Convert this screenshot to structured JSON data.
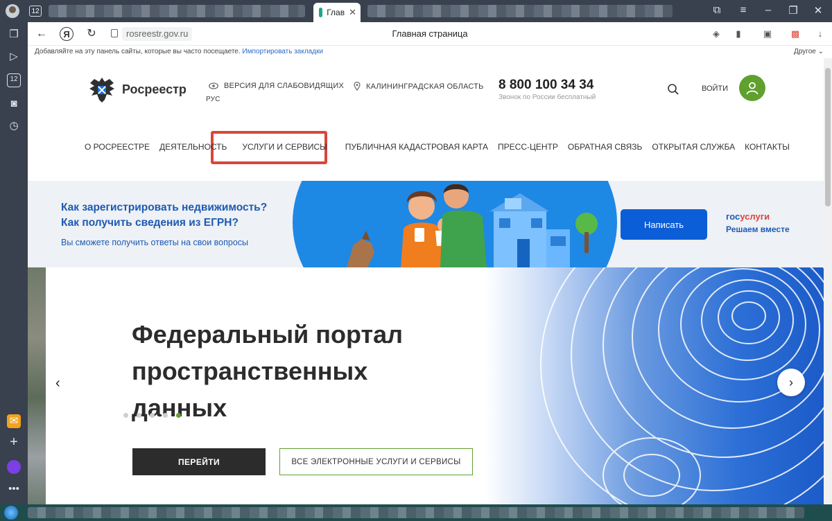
{
  "browser": {
    "tab_count": "12",
    "active_tab_label": "Глав",
    "url": "rosreestr.gov.ru",
    "page_title": "Главная страница",
    "bookmarks_hint": "Добавляйте на эту панель сайты, которые вы часто посещаете.",
    "bookmarks_import": "Импортировать закладки",
    "bookmarks_other": "Другое",
    "sidebar_tab_count": "12"
  },
  "header": {
    "logo_text": "Росреестр",
    "accessibility_label": "ВЕРСИЯ ДЛЯ СЛАБОВИДЯЩИХ",
    "region_label": "КАЛИНИНГРАДСКАЯ ОБЛАСТЬ",
    "language": "РУС",
    "phone": "8 800 100 34 34",
    "phone_note": "Звонок по России бесплатный",
    "login_label": "ВОЙТИ"
  },
  "menu": {
    "items": [
      "О РОСРЕЕСТРЕ",
      "ДЕЯТЕЛЬНОСТЬ",
      "УСЛУГИ И СЕРВИСЫ",
      "ПУБЛИЧНАЯ КАДАСТРОВАЯ КАРТА",
      "ПРЕСС-ЦЕНТР",
      "ОБРАТНАЯ СВЯЗЬ",
      "ОТКРЫТАЯ СЛУЖБА",
      "КОНТАКТЫ"
    ],
    "highlighted_index": 2,
    "highlight_color": "#d9463b"
  },
  "banner": {
    "question_1": "Как зарегистрировать недвижимость?",
    "question_2": "Как получить сведения из ЕГРН?",
    "subtitle": "Вы сможете получить ответы на свои вопросы",
    "write_button": "Написать",
    "gosuslugi_part1": "гос",
    "gosuslugi_part2": "услуги",
    "gosuslugi_tagline": "Решаем вместе"
  },
  "hero": {
    "title": "Федеральный портал пространственных данных",
    "go_button": "ПЕРЕЙТИ",
    "all_services_button": "ВСЕ ЭЛЕКТРОННЫЕ УСЛУГИ И СЕРВИСЫ",
    "slide_count": 5,
    "active_slide": 5
  },
  "colors": {
    "accent_green": "#5fa02e",
    "brand_blue": "#1d5ab3",
    "button_blue": "#0b5ed7",
    "dark_button": "#2c2c2c"
  }
}
